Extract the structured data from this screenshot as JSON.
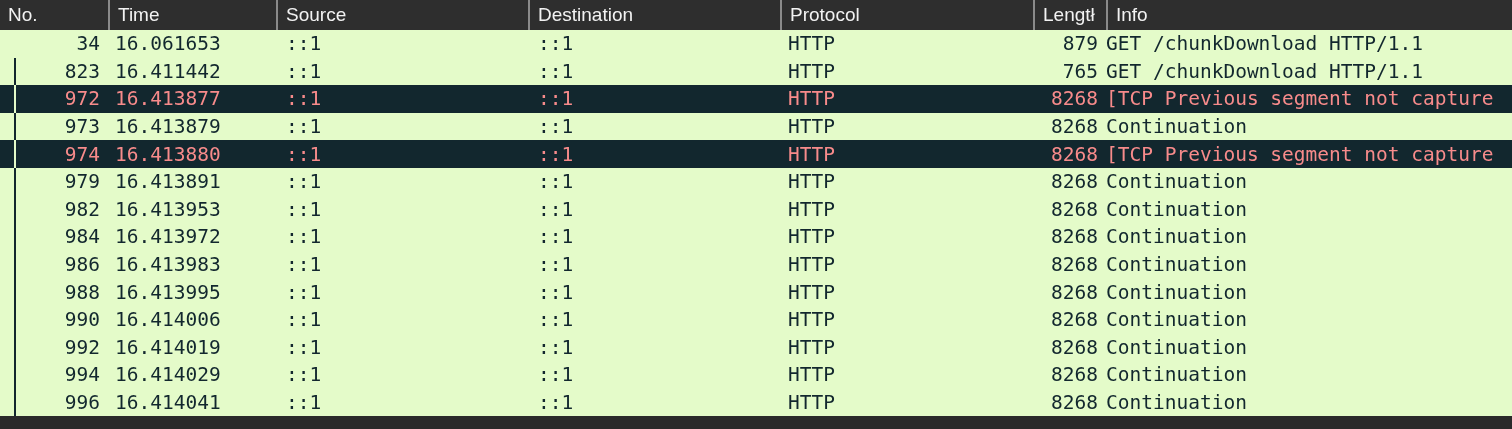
{
  "table": {
    "columns": [
      "No.",
      "Time",
      "Source",
      "Destination",
      "Protocol",
      "Lengtł",
      "Info"
    ],
    "rows": [
      {
        "kind": "normal",
        "related": false,
        "cells": [
          "34",
          "16.061653",
          "::1",
          "::1",
          "HTTP",
          "879",
          "GET /chunkDownload HTTP/1.1"
        ]
      },
      {
        "kind": "normal",
        "related": true,
        "cells": [
          "823",
          "16.411442",
          "::1",
          "::1",
          "HTTP",
          "765",
          "GET /chunkDownload HTTP/1.1"
        ]
      },
      {
        "kind": "error",
        "related": true,
        "cells": [
          "972",
          "16.413877",
          "::1",
          "::1",
          "HTTP",
          "8268",
          "[TCP Previous segment not capture"
        ]
      },
      {
        "kind": "normal",
        "related": true,
        "cells": [
          "973",
          "16.413879",
          "::1",
          "::1",
          "HTTP",
          "8268",
          "Continuation"
        ]
      },
      {
        "kind": "error",
        "related": true,
        "cells": [
          "974",
          "16.413880",
          "::1",
          "::1",
          "HTTP",
          "8268",
          "[TCP Previous segment not capture"
        ]
      },
      {
        "kind": "normal",
        "related": true,
        "cells": [
          "979",
          "16.413891",
          "::1",
          "::1",
          "HTTP",
          "8268",
          "Continuation"
        ]
      },
      {
        "kind": "normal",
        "related": true,
        "cells": [
          "982",
          "16.413953",
          "::1",
          "::1",
          "HTTP",
          "8268",
          "Continuation"
        ]
      },
      {
        "kind": "normal",
        "related": true,
        "cells": [
          "984",
          "16.413972",
          "::1",
          "::1",
          "HTTP",
          "8268",
          "Continuation"
        ]
      },
      {
        "kind": "normal",
        "related": true,
        "cells": [
          "986",
          "16.413983",
          "::1",
          "::1",
          "HTTP",
          "8268",
          "Continuation"
        ]
      },
      {
        "kind": "normal",
        "related": true,
        "cells": [
          "988",
          "16.413995",
          "::1",
          "::1",
          "HTTP",
          "8268",
          "Continuation"
        ]
      },
      {
        "kind": "normal",
        "related": true,
        "cells": [
          "990",
          "16.414006",
          "::1",
          "::1",
          "HTTP",
          "8268",
          "Continuation"
        ]
      },
      {
        "kind": "normal",
        "related": true,
        "cells": [
          "992",
          "16.414019",
          "::1",
          "::1",
          "HTTP",
          "8268",
          "Continuation"
        ]
      },
      {
        "kind": "normal",
        "related": true,
        "cells": [
          "994",
          "16.414029",
          "::1",
          "::1",
          "HTTP",
          "8268",
          "Continuation"
        ]
      },
      {
        "kind": "normal",
        "related": true,
        "cells": [
          "996",
          "16.414041",
          "::1",
          "::1",
          "HTTP",
          "8268",
          "Continuation"
        ]
      }
    ]
  }
}
